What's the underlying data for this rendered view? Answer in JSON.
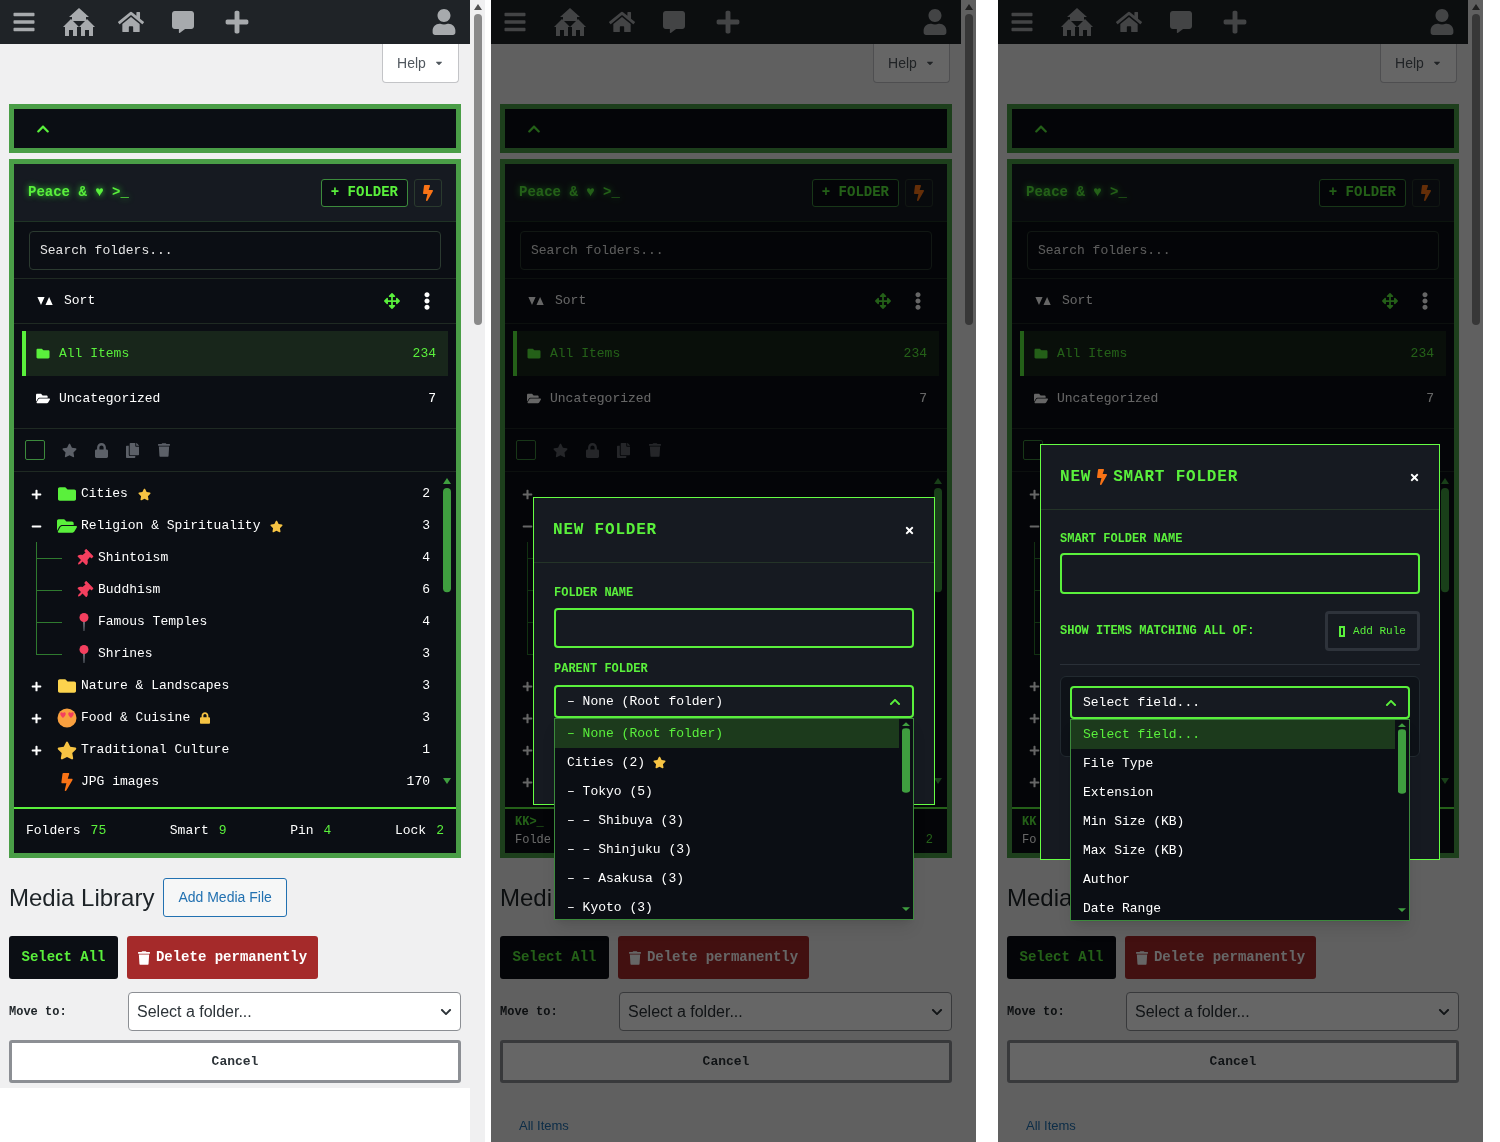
{
  "panels": [
    {
      "dimmed": false,
      "help": "Help",
      "folder_panel": {
        "title": "Peace & ♥ >_",
        "add_button": "+ FOLDER",
        "search": {
          "placeholder": "Search folders..."
        },
        "sort_label": "Sort",
        "views": [
          {
            "label": "All Items",
            "count": "234",
            "kind": "folder",
            "selected": true
          },
          {
            "label": "Uncategorized",
            "count": "7",
            "kind": "tray",
            "selected": false
          }
        ],
        "select_all": {
          "checked": false
        },
        "tree": [
          {
            "name": "Cities",
            "count": "2",
            "kind": "folder",
            "expanded": false,
            "starred": true,
            "locked": false
          },
          {
            "name": "Religion & Spirituality",
            "count": "3",
            "kind": "openfolder",
            "expanded": true,
            "starred": true,
            "locked": false,
            "children": [
              {
                "name": "Shintoism",
                "count": "4",
                "kind": "pushpin",
                "starred": false,
                "locked": false
              },
              {
                "name": "Buddhism",
                "count": "6",
                "kind": "pushpin",
                "starred": false,
                "locked": false
              },
              {
                "name": "Famous Temples",
                "count": "4",
                "kind": "pin",
                "starred": false,
                "locked": false
              },
              {
                "name": "Shrines",
                "count": "3",
                "kind": "pin",
                "starred": false,
                "locked": false
              }
            ]
          },
          {
            "name": "Nature & Landscapes",
            "count": "3",
            "kind": "yellowfolder",
            "expanded": false,
            "starred": false,
            "locked": false
          },
          {
            "name": "Food & Cuisine",
            "count": "3",
            "kind": "emoji",
            "expanded": false,
            "starred": false,
            "locked": true
          },
          {
            "name": "Traditional Culture",
            "count": "1",
            "kind": "starfolder",
            "expanded": false,
            "starred": false,
            "locked": false
          },
          {
            "name": "JPG images",
            "count": "170",
            "kind": "smart",
            "starred": false,
            "locked": false
          }
        ],
        "footer": {
          "kind": "stats",
          "stats": [
            {
              "label": "Folders",
              "value": "75"
            },
            {
              "label": "Smart",
              "value": "9"
            },
            {
              "label": "Pin",
              "value": "4"
            },
            {
              "label": "Lock",
              "value": "2"
            }
          ]
        }
      },
      "media": {
        "title": "Media Library",
        "add_button": "Add Media File"
      },
      "select_all_button": "Select All",
      "delete_button": "Delete permanently",
      "move_to": {
        "label": "Move to:",
        "value": "Select a folder..."
      },
      "cancel": "Cancel"
    },
    {
      "dimmed": true,
      "help": "Help",
      "folder_panel": {
        "title": "Peace & ♥ >_",
        "add_button": "+ FOLDER",
        "search": {
          "placeholder": "Search folders..."
        },
        "sort_label": "Sort",
        "views": [
          {
            "label": "All Items",
            "count": "234",
            "kind": "folder",
            "selected": true
          },
          {
            "label": "Uncategorized",
            "count": "7",
            "kind": "tray",
            "selected": false
          }
        ],
        "select_all": {
          "checked": false
        },
        "tree": [
          {
            "kind": "covered",
            "expanded": false
          },
          {
            "kind": "covered",
            "expanded": true,
            "children": [
              {
                "kind": "covered"
              },
              {
                "kind": "covered"
              },
              {
                "kind": "covered"
              },
              {
                "kind": "covered"
              }
            ]
          },
          {
            "kind": "covered",
            "expanded": false
          },
          {
            "kind": "covered",
            "expanded": false
          },
          {
            "kind": "covered",
            "expanded": false
          },
          {
            "kind": "covered",
            "expanded": false
          }
        ],
        "footer": {
          "kind": "brand",
          "brand": "KK>_",
          "label": "Folde",
          "value": "2"
        }
      },
      "media": {
        "title": "Medi"
      },
      "select_all_button": "Select All",
      "delete_button": "Delete permanently",
      "move_to": {
        "label": "Move to:",
        "value": "Select a folder..."
      },
      "cancel": "Cancel",
      "link": "All Items",
      "modal": {
        "kind": "folder",
        "title": [
          "NEW FOLDER"
        ],
        "name_label": "FOLDER NAME",
        "parent_label": "PARENT FOLDER",
        "select": {
          "value": "– None (Root folder)",
          "expanded": true,
          "options": [
            {
              "label": "– None (Root folder)",
              "selected": true,
              "starred": false
            },
            {
              "label": "Cities (2)",
              "selected": false,
              "starred": true
            },
            {
              "label": "– Tokyo (5)",
              "selected": false,
              "starred": false
            },
            {
              "label": "– – Shibuya (3)",
              "selected": false,
              "starred": false
            },
            {
              "label": "– – Shinjuku (3)",
              "selected": false,
              "starred": false
            },
            {
              "label": "– – Asakusa (3)",
              "selected": false,
              "starred": false
            },
            {
              "label": "– Kyoto (3)",
              "selected": false,
              "starred": false
            }
          ]
        }
      }
    },
    {
      "dimmed": true,
      "help": "Help",
      "folder_panel": {
        "title": "Peace & ♥ >_",
        "add_button": "+ FOLDER",
        "search": {
          "placeholder": "Search folders..."
        },
        "sort_label": "Sort",
        "views": [
          {
            "label": "All Items",
            "count": "234",
            "kind": "folder",
            "selected": true
          },
          {
            "label": "Uncategorized",
            "count": "7",
            "kind": "tray",
            "selected": false
          }
        ],
        "select_all": {
          "checked": false
        },
        "tree": [
          {
            "kind": "covered",
            "expanded": false
          },
          {
            "kind": "covered",
            "expanded": true,
            "children": [
              {
                "kind": "covered"
              },
              {
                "kind": "covered"
              },
              {
                "kind": "covered"
              },
              {
                "kind": "covered"
              }
            ]
          },
          {
            "kind": "covered",
            "expanded": false
          },
          {
            "kind": "covered",
            "expanded": false
          },
          {
            "kind": "covered",
            "expanded": false
          },
          {
            "kind": "covered",
            "expanded": false
          }
        ],
        "footer": {
          "kind": "brand",
          "brand": "KK",
          "label": "Fo"
        }
      },
      "media": {
        "title": "Media"
      },
      "select_all_button": "Select All",
      "delete_button": "Delete permanently",
      "move_to": {
        "label": "Move to:",
        "value": "Select a folder..."
      },
      "cancel": "Cancel",
      "link": "All Items",
      "modal": {
        "kind": "smart",
        "title": [
          "NEW",
          "SMART FOLDER"
        ],
        "name_label": "SMART FOLDER NAME",
        "rules_label": "SHOW ITEMS MATCHING ALL OF:",
        "add_rule": "Add Rule",
        "select": {
          "value": "Select field...",
          "expanded": true,
          "options": [
            {
              "label": "Select field...",
              "selected": true
            },
            {
              "label": "File Type",
              "selected": false
            },
            {
              "label": "Extension",
              "selected": false
            },
            {
              "label": "Min Size (KB)",
              "selected": false
            },
            {
              "label": "Max Size (KB)",
              "selected": false
            },
            {
              "label": "Author",
              "selected": false
            },
            {
              "label": "Date Range",
              "selected": false
            }
          ]
        }
      }
    }
  ]
}
